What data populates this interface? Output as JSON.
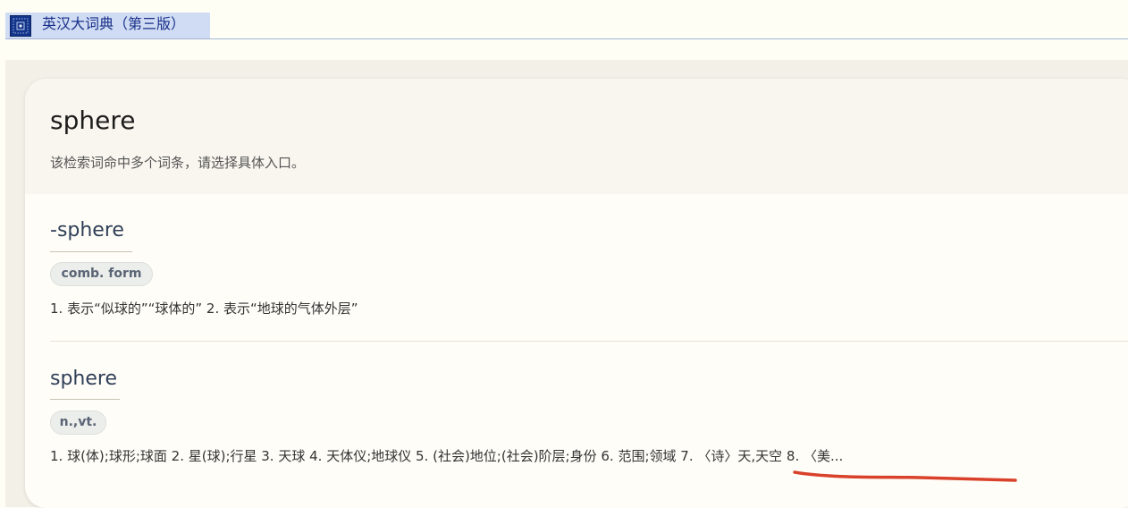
{
  "window": {
    "title": "英汉大词典（第三版）",
    "icon": "dictionary-icon"
  },
  "search": {
    "headword": "sphere",
    "hint": "该检索词命中多个词条，请选择具体入口。"
  },
  "entries": [
    {
      "title": "-sphere",
      "pos": "comb. form",
      "definition": "1. 表示“似球的”“球体的” 2. 表示“地球的气体外层”"
    },
    {
      "title": "sphere",
      "pos": "n.,vt.",
      "definition": "1. 球(体);球形;球面 2. 星(球);行星 3. 天球 4. 天体仪;地球仪 5. (社会)地位;(社会)阶层;身份 6. 范围;领域 7. 〈诗〉天,天空 8. 〈美..."
    }
  ],
  "colors": {
    "annotation": "#d9412b",
    "title_bar": "#cfdcf3",
    "link": "#2f3f58"
  }
}
